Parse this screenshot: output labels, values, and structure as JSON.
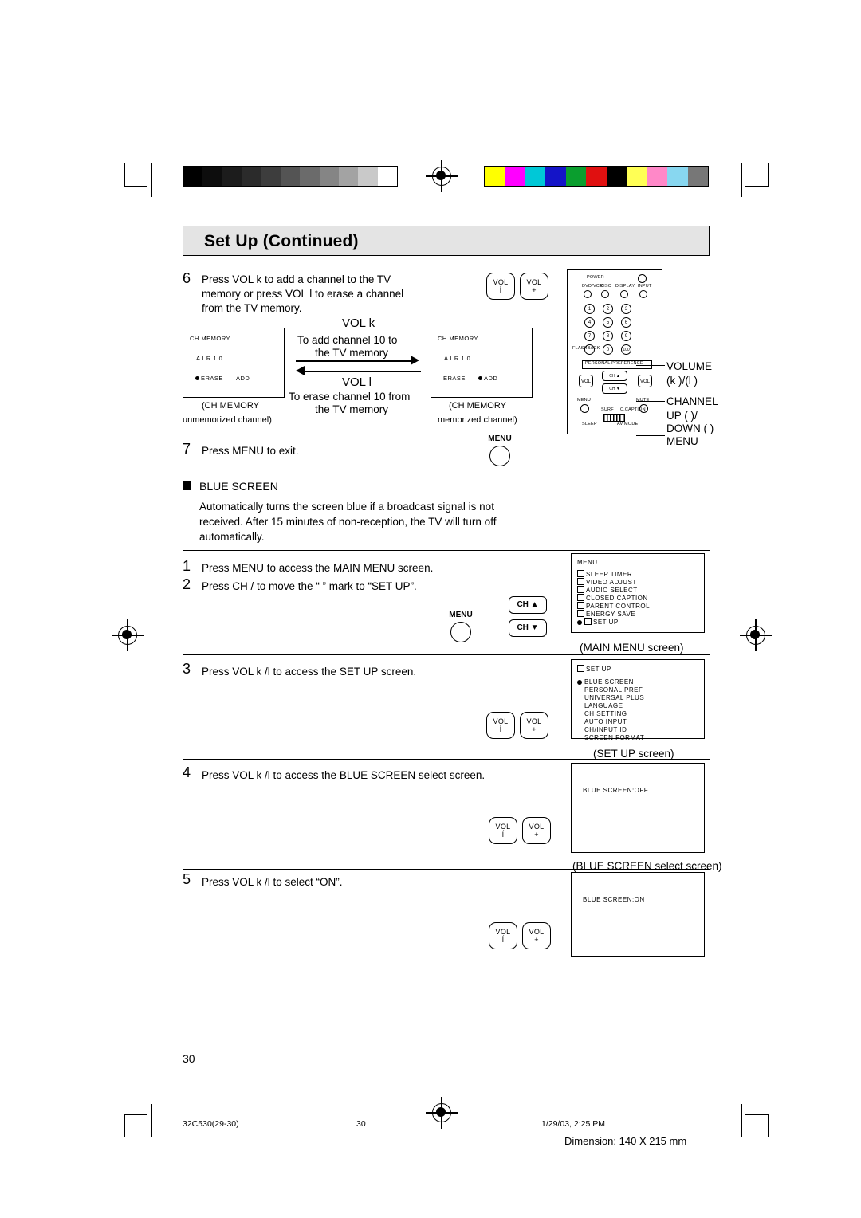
{
  "page": {
    "title": "Set Up (Continued)",
    "page_number": "30",
    "footer_left": "32C530(29-30)",
    "footer_center": "30",
    "footer_right": "1/29/03, 2:25 PM",
    "footer_dimension": "Dimension: 140  X  215 mm"
  },
  "steps": {
    "s6": {
      "num": "6",
      "line1": "Press VOL k  to add a channel to the TV",
      "line2": "memory or press VOL l   to erase a channel",
      "line3": "from the TV memory."
    },
    "s7": {
      "num": "7",
      "text": "Press MENU to exit."
    },
    "s1": {
      "num": "1",
      "text": "Press MENU to access the MAIN MENU screen."
    },
    "s2": {
      "num": "2",
      "text": "Press CH   /   to move the “   ” mark to “SET UP”."
    },
    "s3": {
      "num": "3",
      "text": "Press VOL k  /l   to access the SET UP screen."
    },
    "s4": {
      "num": "4",
      "text": "Press VOL k  /l   to access the BLUE SCREEN select screen."
    },
    "s5": {
      "num": "5",
      "text": "Press VOL k  /l   to select “ON”."
    }
  },
  "diagram6": {
    "vol_up_label": "VOL  k",
    "add_text_l1": "To  add  channel  10  to",
    "add_text_l2": "the  TV  memory",
    "vol_down_label": "VOL  l",
    "erase_text_l1": "To  erase  channel  10  from",
    "erase_text_l2": "the  TV  memory",
    "left_screen": {
      "header": "CH MEMORY",
      "channel": "A I R   1 0",
      "opt_erase": "ERASE",
      "opt_add": "ADD"
    },
    "right_screen": {
      "header": "CH MEMORY",
      "channel": "A I R   1 0",
      "opt_erase": "ERASE",
      "opt_add": "ADD"
    },
    "left_caption_l1": "(CH MEMORY",
    "left_caption_l2": "unmemorized channel)",
    "right_caption_l1": "(CH MEMORY",
    "right_caption_l2": "memorized channel)"
  },
  "buttons": {
    "vol_down": {
      "l1": "VOL",
      "l2": "ĺ"
    },
    "vol_up": {
      "l1": "VOL",
      "l2": "+"
    },
    "menu": "MENU",
    "ch_up": "CH ▲",
    "ch_down": "CH ▼"
  },
  "remote": {
    "power": "POWER",
    "top_row": [
      "DVD/VCR",
      "DISC",
      "DISPLAY",
      "INPUT"
    ],
    "keys": [
      "1",
      "2",
      "3",
      "4",
      "5",
      "6",
      "7",
      "8",
      "9",
      "0",
      "100"
    ],
    "flashback": "FLASHBACK",
    "personal_pref": "PERSONAL PREFERENCE",
    "vol_minus": "VOL",
    "vol_plus": "VOL",
    "ch_up": "CH ▲",
    "ch_down": "CH ▼",
    "menu": "MENU",
    "mute": "MUTE",
    "surf": "SURF",
    "sleep": "SLEEP",
    "cc": "C.CAPTION",
    "av": "AV MODE"
  },
  "remote_callouts": {
    "volume": "VOLUME",
    "volume_sub": "(k  )/(l     )",
    "channel": "CHANNEL",
    "up": "UP (    )/",
    "down": "DOWN (    )",
    "menu": "MENU"
  },
  "blue_screen_section": {
    "heading": "BLUE SCREEN",
    "body_l1": "Automatically turns the screen blue if a broadcast signal is not",
    "body_l2": "received. After 15 minutes of non-reception, the TV will turn off",
    "body_l3": "automatically."
  },
  "main_menu_screen": {
    "title": "MENU",
    "items": [
      "SLEEP  TIMER",
      "VIDEO  ADJUST",
      "AUDIO  SELECT",
      "CLOSED  CAPTION",
      "PARENT  CONTROL",
      "ENERGY  SAVE",
      "SET  UP"
    ],
    "caption": "(MAIN  MENU  screen)"
  },
  "setup_screen": {
    "title": "SET  UP",
    "items": [
      "BLUE SCREEN",
      "PERSONAL PREF.",
      "UNIVERSAL PLUS",
      "LANGUAGE",
      "CH SETTING",
      "AUTO INPUT",
      "CH/INPUT ID",
      "SCREEN FORMAT"
    ],
    "caption": "(SET  UP  screen)"
  },
  "blue_select_screen": {
    "line": "BLUE SCREEN:OFF",
    "caption": "(BLUE SCREEN select screen)"
  },
  "blue_on_screen": {
    "line": "BLUE SCREEN:ON"
  },
  "colors": {
    "title_bg": "#e4e4e4",
    "gray_steps": [
      "#000000",
      "#111111",
      "#222222",
      "#333333",
      "#444444",
      "#5a5a5a",
      "#707070",
      "#8a8a8a",
      "#a8a8a8",
      "#c8c8c8",
      "#ffffff"
    ],
    "color_steps": [
      "#ffff00",
      "#ff00ff",
      "#00ffff",
      "#0000ff",
      "#00a000",
      "#ff0000",
      "#000000",
      "#ffff00",
      "#ff66cc",
      "#66ccff",
      "#888888"
    ]
  }
}
